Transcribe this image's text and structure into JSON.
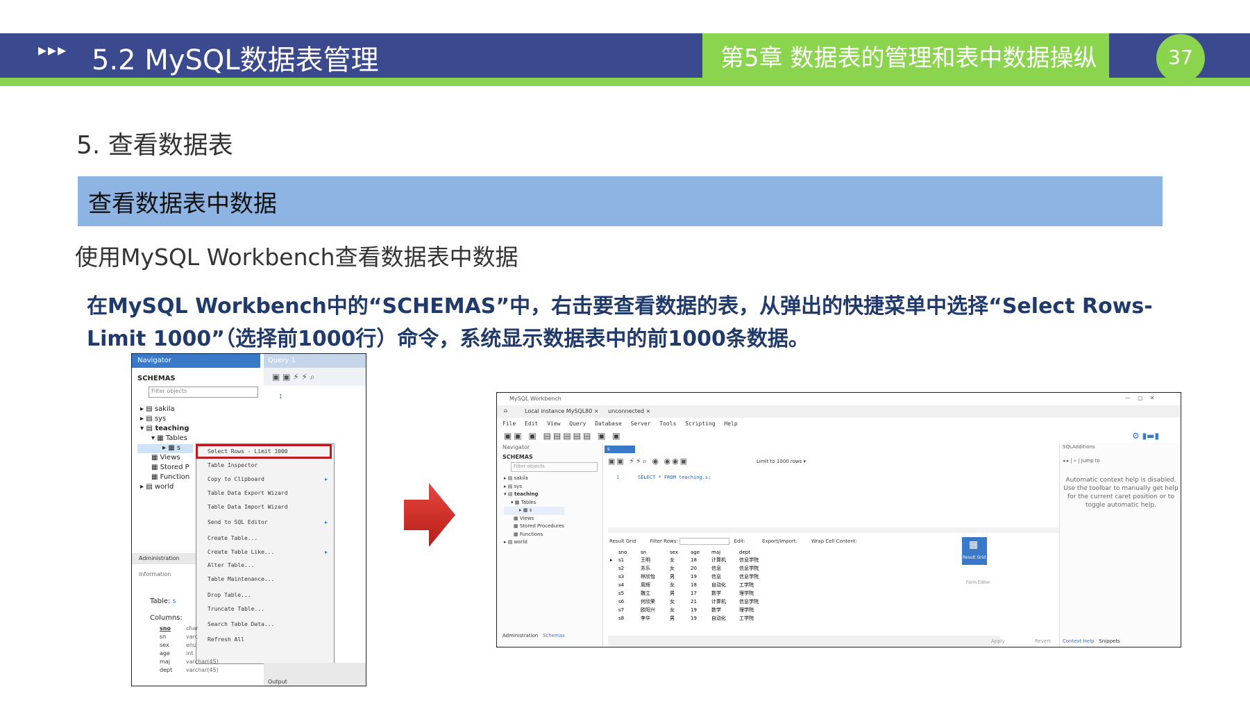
{
  "header": {
    "arrows": "▸▸▸",
    "title": "5.2  MySQL数据表管理",
    "chapter": "第5章 数据表的管理和表中数据操纵",
    "page_number": "37"
  },
  "section_title": "5. 查看数据表",
  "bar_title": "查看数据表中数据",
  "intro": "使用MySQL Workbench查看数据表中数据",
  "description": "在MySQL Workbench中的“SCHEMAS”中，右击要查看数据的表，从弹出的快捷菜单中选择“Select Rows-Limit 1000”（选择前1000行）命令，系统显示数据表中的前1000条数据。",
  "shot1": {
    "navigator": "Navigator",
    "query_tab": "Query 1",
    "schemas": "SCHEMAS",
    "filter_placeholder": "Filter objects",
    "line_no": "1",
    "tree": [
      "sakila",
      "sys",
      "teaching",
      "Tables",
      "s",
      "Views",
      "Stored P",
      "Function",
      "world"
    ],
    "menu": [
      "Select Rows - Limit 1000",
      "Table Inspector",
      "Copy to Clipboard",
      "Table Data Export Wizard",
      "Table Data Import Wizard",
      "Send to SQL Editor",
      "Create Table...",
      "Create Table Like...",
      "Alter Table...",
      "Table Maintenance...",
      "Drop Table...",
      "Truncate Table...",
      "Search Table Data...",
      "Refresh All"
    ],
    "admin_tab": "Administration",
    "information": "Information",
    "table_label": "Table:",
    "table_name": "s",
    "columns_label": "Columns:",
    "columns": [
      {
        "name": "sno",
        "type": "char"
      },
      {
        "name": "sn",
        "type": "varc"
      },
      {
        "name": "sex",
        "type": "enu"
      },
      {
        "name": "age",
        "type": "int"
      },
      {
        "name": "maj",
        "type": "varchar(45)"
      },
      {
        "name": "dept",
        "type": "varchar(45)"
      }
    ],
    "output": "Output"
  },
  "shot2": {
    "window_title": "MySQL Workbench",
    "tab_instance": "Local instance MySQL80",
    "tab_unconnected": "unconnected",
    "menu": [
      "File",
      "Edit",
      "View",
      "Query",
      "Database",
      "Server",
      "Tools",
      "Scripting",
      "Help"
    ],
    "navigator": "Navigator",
    "schemas": "SCHEMAS",
    "filter_placeholder": "Filter objects",
    "tree": [
      "sakila",
      "sys",
      "teaching",
      "Tables",
      "s",
      "Views",
      "Stored Procedures",
      "Functions",
      "world"
    ],
    "query_tab": "s",
    "limit": "Limit to 1000 rows",
    "sql_line": "1",
    "sql": "SELECT * FROM teaching.s;",
    "result_grid": "Result Grid",
    "filter_rows": "Filter Rows:",
    "edit": "Edit:",
    "export": "Export/Import:",
    "wrap": "Wrap Cell Content:",
    "sqladditions": "SQLAdditions",
    "jump_to": "Jump to",
    "help_text": "Automatic context help is disabled. Use the toolbar to manually get help for the current caret position or to toggle automatic help.",
    "side_result": "Result Grid",
    "side_form": "Form Editor",
    "bottom_admin": "Administration",
    "bottom_schemas": "Schemas",
    "apply": "Apply",
    "revert": "Revert",
    "context_help": "Context Help",
    "snippets": "Snippets",
    "columns": [
      "sno",
      "sn",
      "sex",
      "age",
      "maj",
      "dept"
    ],
    "rows": [
      [
        "s1",
        "王明",
        "女",
        "18",
        "计算机",
        "信息学院"
      ],
      [
        "s2",
        "苏乐",
        "女",
        "20",
        "信息",
        "信息学院"
      ],
      [
        "s3",
        "林欣怡",
        "男",
        "19",
        "信息",
        "信息学院"
      ],
      [
        "s4",
        "周辉",
        "女",
        "18",
        "自动化",
        "工学院"
      ],
      [
        "s5",
        "魏立",
        "男",
        "17",
        "数学",
        "理学院"
      ],
      [
        "s6",
        "何欣荣",
        "女",
        "21",
        "计算机",
        "信息学院"
      ],
      [
        "s7",
        "欧阳兴",
        "女",
        "19",
        "数学",
        "理学院"
      ],
      [
        "s8",
        "李华",
        "男",
        "19",
        "自动化",
        "工学院"
      ]
    ]
  }
}
